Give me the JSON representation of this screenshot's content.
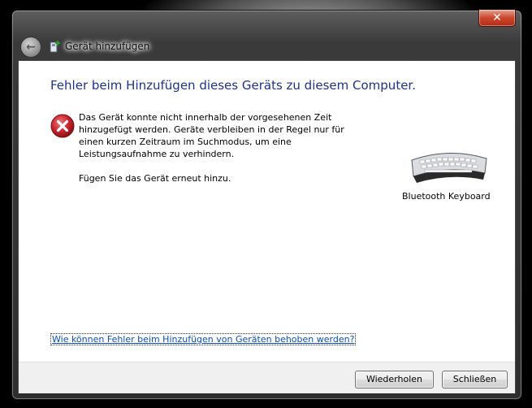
{
  "window": {
    "title": "Gerät hinzufügen",
    "close_glyph": "✕",
    "back_glyph": "←"
  },
  "content": {
    "heading": "Fehler beim Hinzufügen dieses Geräts zu diesem Computer.",
    "message": "Das Gerät konnte nicht innerhalb der vorgesehenen Zeit hinzugefügt werden. Geräte verbleiben in der Regel nur für einen kurzen Zeitraum im Suchmodus, um eine Leistungsaufnahme zu verhindern.",
    "retry_hint": "Fügen Sie das Gerät erneut hinzu.",
    "device_label": "Bluetooth Keyboard",
    "help_link": "Wie können Fehler beim Hinzufügen von Geräten behoben werden?"
  },
  "buttons": {
    "retry": "Wiederholen",
    "close": "Schließen"
  },
  "icons": {
    "error": "error-icon",
    "device": "keyboard-icon",
    "title": "add-device-icon"
  },
  "colors": {
    "heading": "#1e3287",
    "link": "#0b4fb5",
    "error_red": "#c8232c"
  }
}
